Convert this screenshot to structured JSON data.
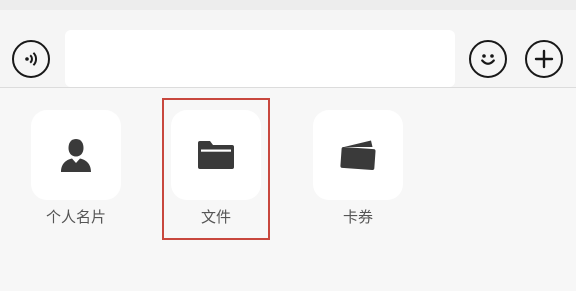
{
  "input_bar": {
    "voice_icon": "voice-icon",
    "emoji_icon": "emoji-icon",
    "plus_icon": "plus-icon",
    "message_value": ""
  },
  "panel": {
    "items": [
      {
        "label": "个人名片",
        "icon": "contact-card-icon"
      },
      {
        "label": "文件",
        "icon": "folder-icon"
      },
      {
        "label": "卡券",
        "icon": "wallet-card-icon"
      }
    ],
    "highlighted_item": "文件",
    "highlight_color": "#c8473d"
  }
}
